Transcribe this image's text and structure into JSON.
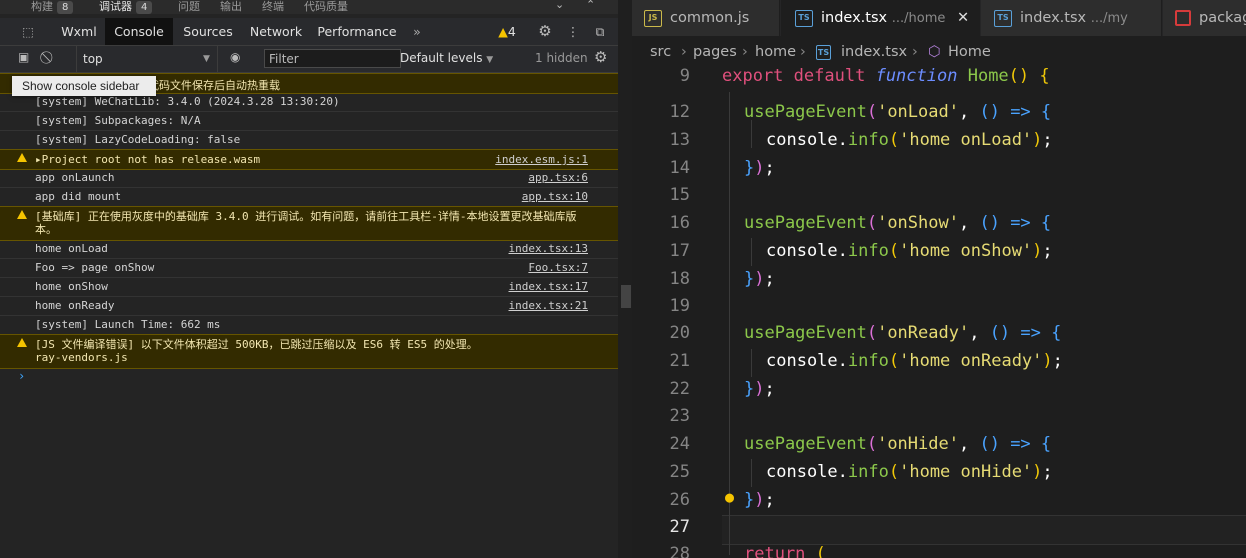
{
  "devtools": {
    "top_tabs": [
      {
        "label": "构建",
        "badge": "8"
      },
      {
        "label": "调试器",
        "badge": "4"
      },
      {
        "label": "问题"
      },
      {
        "label": "输出"
      },
      {
        "label": "终端"
      },
      {
        "label": "代码质量"
      }
    ],
    "tabs": [
      "Wxml",
      "Console",
      "Sources",
      "Network",
      "Performance"
    ],
    "active_tab": "Console",
    "warning_count": "4",
    "context_selector": "top",
    "filter_placeholder": "Filter",
    "levels": "Default levels",
    "hidden_count": "1 hidden",
    "tooltip": "Show console sidebar",
    "first_line_visible": "代码文件保存后自动热重载",
    "console_lines": [
      {
        "msg": "[system] WeChatLib: 3.4.0 (2024.3.28 13:30:20)",
        "src": "",
        "warn": false
      },
      {
        "msg": "[system] Subpackages: N/A",
        "src": "",
        "warn": false
      },
      {
        "msg": "[system] LazyCodeLoading: false",
        "src": "",
        "warn": false
      },
      {
        "msg": "▸Project root not has release.wasm",
        "src": "index.esm.js:1",
        "warn": true
      },
      {
        "msg": "app onLaunch",
        "src": "app.tsx:6",
        "warn": false
      },
      {
        "msg": "app did mount",
        "src": "app.tsx:10",
        "warn": false
      },
      {
        "msg": "[基础库] 正在使用灰度中的基础库 3.4.0 进行调试。如有问题，请前往工具栏-详情-本地设置更改基础库版\n本。",
        "src": "",
        "warn": true
      },
      {
        "msg": "home onLoad",
        "src": "index.tsx:13",
        "warn": false
      },
      {
        "msg": "Foo => page onShow",
        "src": "Foo.tsx:7",
        "warn": false
      },
      {
        "msg": "home onShow",
        "src": "index.tsx:17",
        "warn": false
      },
      {
        "msg": "home onReady",
        "src": "index.tsx:21",
        "warn": false
      },
      {
        "msg": "[system] Launch Time: 662 ms",
        "src": "",
        "warn": false
      },
      {
        "msg": "[JS 文件编译错误] 以下文件体积超过 500KB，已跳过压缩以及 ES6 转 ES5 的处理。\nray-vendors.js",
        "src": "",
        "warn": true
      }
    ],
    "prompt": "›"
  },
  "editor": {
    "tabs": [
      {
        "icon": "JS",
        "label": "common.js",
        "path": ""
      },
      {
        "icon": "TS",
        "label": "index.tsx",
        "path": ".../home",
        "active": true
      },
      {
        "icon": "TS",
        "label": "index.tsx",
        "path": ".../my"
      },
      {
        "icon": "PKG",
        "label": "packag",
        "path": ""
      }
    ],
    "breadcrumb": [
      "src",
      "pages",
      "home",
      "index.tsx",
      "Home"
    ],
    "line_numbers": [
      "9",
      "12",
      "13",
      "14",
      "15",
      "16",
      "17",
      "18",
      "19",
      "20",
      "21",
      "22",
      "23",
      "24",
      "25",
      "26",
      "27",
      "28"
    ],
    "code": {
      "l9_kw1": "export",
      "l9_kw2": "default",
      "l9_kw3": "function",
      "l9_name": "Home",
      "hook": "usePageEvent",
      "events": [
        "'onLoad'",
        "'onShow'",
        "'onReady'",
        "'onHide'"
      ],
      "logs": [
        "'home onLoad'",
        "'home onShow'",
        "'home onReady'",
        "'home onHide'"
      ],
      "console": "console",
      "info": "info",
      "return_kw": "return"
    }
  }
}
